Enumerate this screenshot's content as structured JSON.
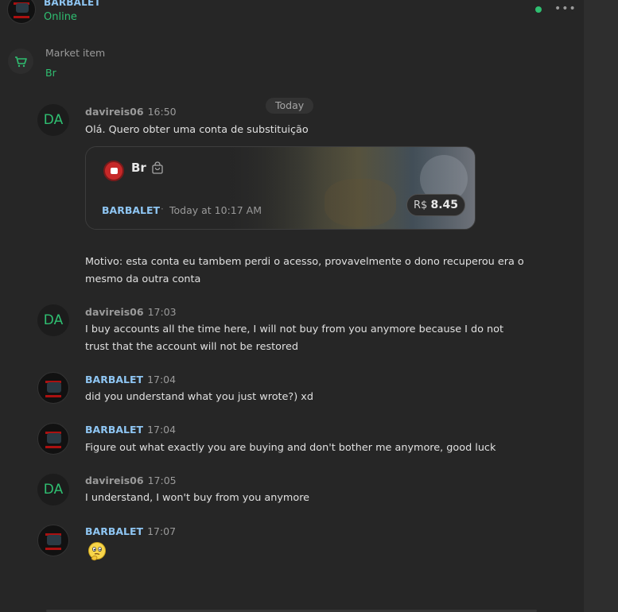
{
  "header": {
    "name": "BARBALET",
    "status": "Online"
  },
  "market": {
    "label": "Market item",
    "value": "Br"
  },
  "day_divider": "Today",
  "messages": [
    {
      "avatar_text": "DA",
      "author": "davireis06",
      "time": "16:50",
      "text": "Olá. Quero obter uma conta de substituição"
    },
    {
      "author": "",
      "time": "",
      "text": "Motivo: esta conta eu tambem perdi o acesso, provavelmente o dono recuperou era o mesmo da outra conta"
    },
    {
      "avatar_text": "DA",
      "author": "davireis06",
      "time": "17:03",
      "text": "I buy accounts all the time here, I will not buy from you anymore because I do not trust that the account will not be restored"
    },
    {
      "author": "BARBALET",
      "time": "17:04",
      "text": "did you understand what you just wrote?) xd"
    },
    {
      "author": "BARBALET",
      "time": "17:04",
      "text": "Figure out what exactly you are buying and don't bother me anymore, good luck"
    },
    {
      "avatar_text": "DA",
      "author": "davireis06",
      "time": "17:05",
      "text": "I understand, I won't buy from you anymore"
    },
    {
      "author": "BARBALET",
      "time": "17:07",
      "emoji": "thinking-face-emoji"
    }
  ],
  "card": {
    "title": "Br",
    "seller": "BARBALET",
    "separator": "·",
    "date": "Today at 10:17 AM",
    "currency": "R$",
    "price": "8.45"
  },
  "colors": {
    "background": "#262626",
    "online": "#2fbf71",
    "seller_name": "#8ec5f2",
    "avatar_text": "#2fbf71"
  }
}
